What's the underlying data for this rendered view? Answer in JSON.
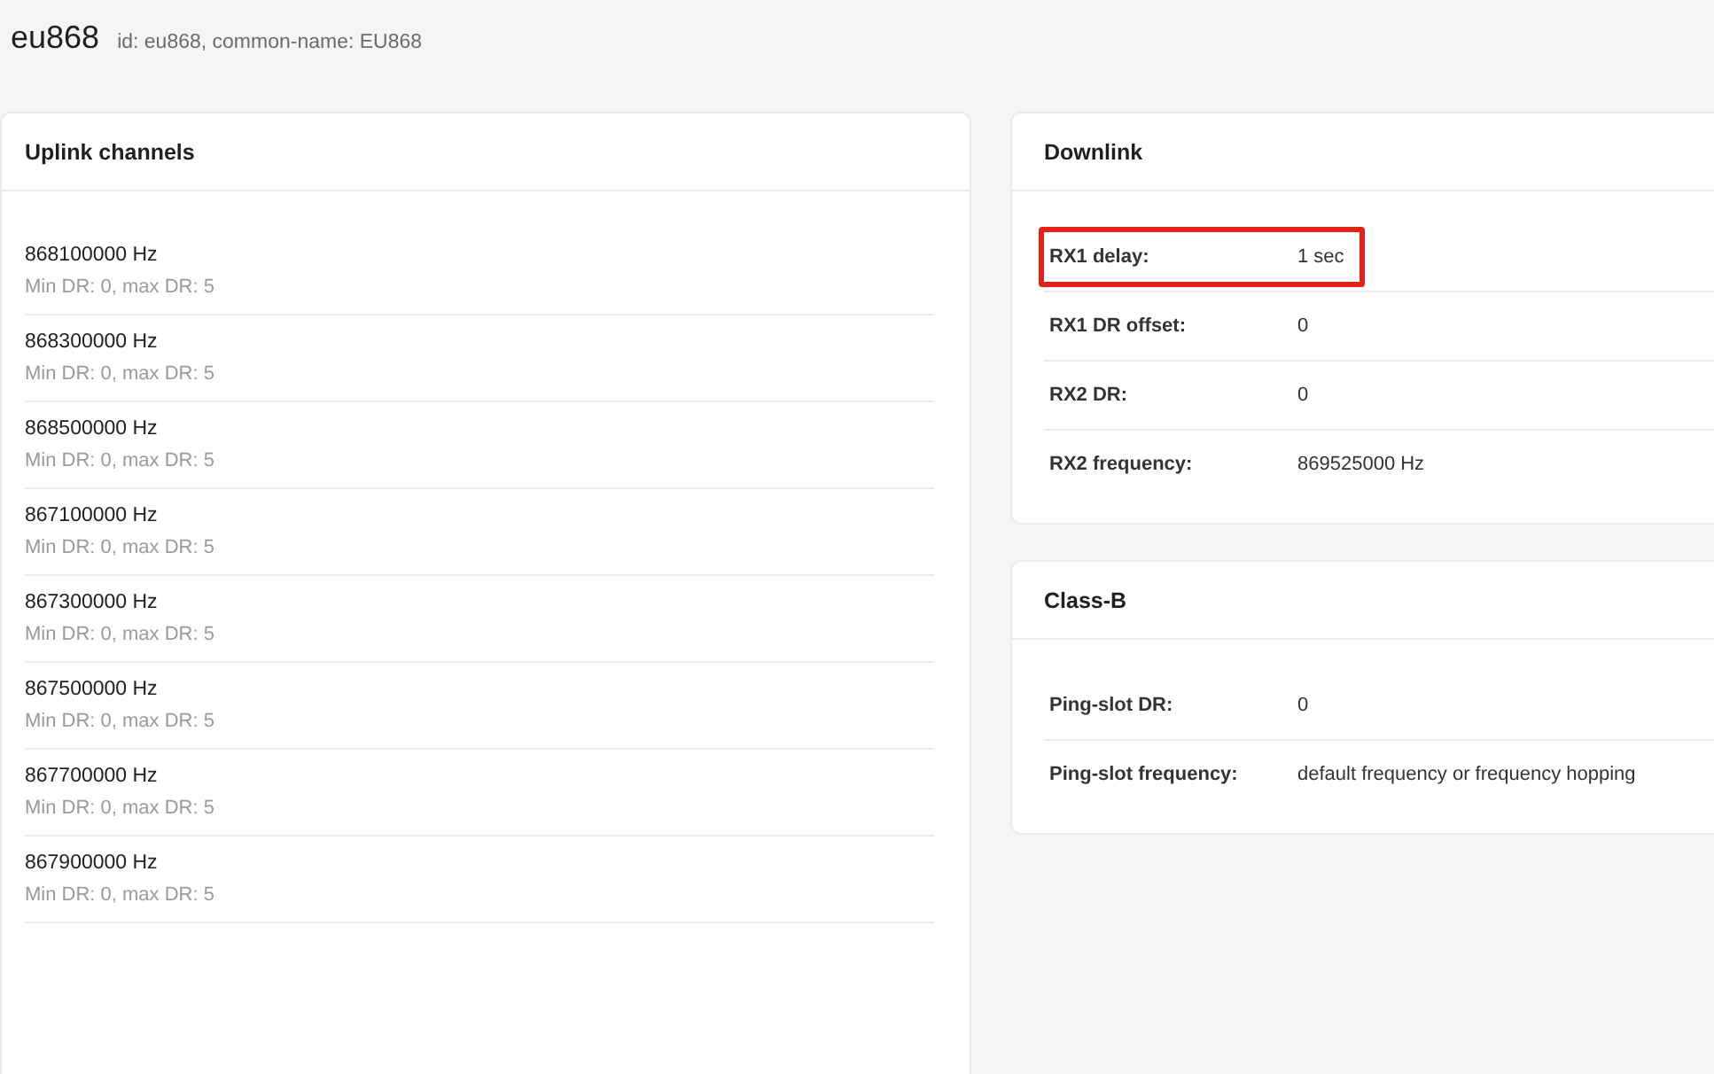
{
  "header": {
    "title": "eu868",
    "subtitle": "id: eu868, common-name: EU868"
  },
  "uplink": {
    "title": "Uplink channels",
    "channels": [
      {
        "frequency": "868100000 Hz",
        "range": "Min DR: 0, max DR: 5"
      },
      {
        "frequency": "868300000 Hz",
        "range": "Min DR: 0, max DR: 5"
      },
      {
        "frequency": "868500000 Hz",
        "range": "Min DR: 0, max DR: 5"
      },
      {
        "frequency": "867100000 Hz",
        "range": "Min DR: 0, max DR: 5"
      },
      {
        "frequency": "867300000 Hz",
        "range": "Min DR: 0, max DR: 5"
      },
      {
        "frequency": "867500000 Hz",
        "range": "Min DR: 0, max DR: 5"
      },
      {
        "frequency": "867700000 Hz",
        "range": "Min DR: 0, max DR: 5"
      },
      {
        "frequency": "867900000 Hz",
        "range": "Min DR: 0, max DR: 5"
      }
    ]
  },
  "downlink": {
    "title": "Downlink",
    "rows": [
      {
        "label": "RX1 delay:",
        "value": "1 sec",
        "highlighted": true
      },
      {
        "label": "RX1 DR offset:",
        "value": "0",
        "highlighted": false
      },
      {
        "label": "RX2 DR:",
        "value": "0",
        "highlighted": false
      },
      {
        "label": "RX2 frequency:",
        "value": "869525000 Hz",
        "highlighted": false
      }
    ]
  },
  "class_b": {
    "title": "Class-B",
    "rows": [
      {
        "label": "Ping-slot DR:",
        "value": "0",
        "highlighted": false
      },
      {
        "label": "Ping-slot frequency:",
        "value": "default frequency or frequency hopping",
        "highlighted": false
      }
    ]
  }
}
